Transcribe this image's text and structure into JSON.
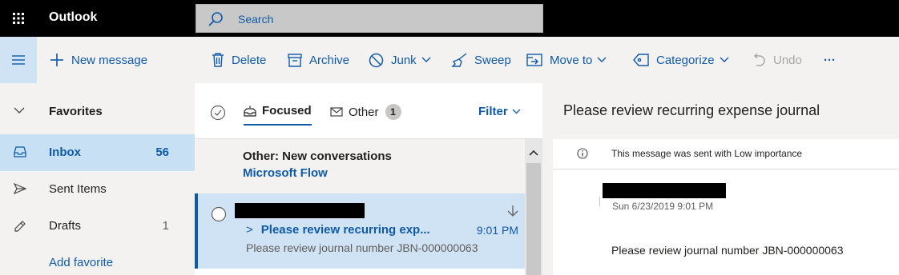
{
  "topbar": {
    "app_name": "Outlook",
    "search_placeholder": "Search"
  },
  "commandbar": {
    "new_message": "New message",
    "delete": "Delete",
    "archive": "Archive",
    "junk": "Junk",
    "sweep": "Sweep",
    "move_to": "Move to",
    "categorize": "Categorize",
    "undo": "Undo",
    "more": "···"
  },
  "nav": {
    "favorites": "Favorites",
    "items": [
      {
        "label": "Inbox",
        "count": "56"
      },
      {
        "label": "Sent Items",
        "count": ""
      },
      {
        "label": "Drafts",
        "count": "1"
      }
    ],
    "add_favorite": "Add favorite"
  },
  "list": {
    "tabs": [
      {
        "label": "Focused"
      },
      {
        "label": "Other",
        "badge": "1"
      }
    ],
    "filter": "Filter",
    "other_notice": {
      "title": "Other: New conversations",
      "sender": "Microsoft Flow"
    },
    "messages": [
      {
        "subject": "Please review recurring exp...",
        "time": "9:01 PM",
        "preview": "Please review journal number JBN-000000063"
      }
    ]
  },
  "reading": {
    "subject": "Please review recurring expense journal",
    "importance_note": "This message was sent with Low importance",
    "date": "Sun 6/23/2019 9:01 PM",
    "body": "Please review journal number JBN-000000063"
  },
  "colors": {
    "accent": "#0f5aa8",
    "topbar": "#000000",
    "selected_bg": "#cfe3f5"
  }
}
